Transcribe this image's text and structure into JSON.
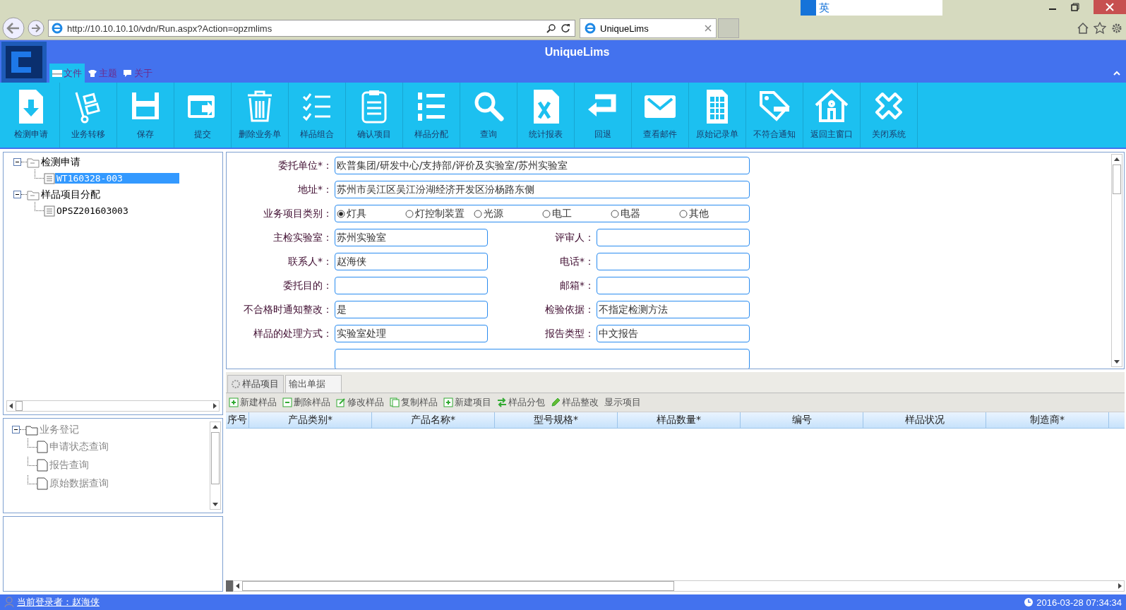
{
  "browser": {
    "url": "http://10.10.10.10/vdn/Run.aspx?Action=opzmlims",
    "tab_title": "UniqueLims",
    "ime_label": "英"
  },
  "app": {
    "title": "UniqueLims"
  },
  "menu": [
    {
      "label": "文件",
      "selected": true
    },
    {
      "label": "主题",
      "selected": false
    },
    {
      "label": "关于",
      "selected": false
    }
  ],
  "toolbar": [
    {
      "label": "检测申请"
    },
    {
      "label": "业务转移"
    },
    {
      "label": "保存"
    },
    {
      "label": "提交"
    },
    {
      "label": "删除业务单"
    },
    {
      "label": "样品组合"
    },
    {
      "label": "确认项目"
    },
    {
      "label": "样品分配"
    },
    {
      "label": "查询"
    },
    {
      "label": "统计报表"
    },
    {
      "label": "回退"
    },
    {
      "label": "查看邮件"
    },
    {
      "label": "原始记录单"
    },
    {
      "label": "不符合通知"
    },
    {
      "label": "返回主窗口"
    },
    {
      "label": "关闭系统"
    }
  ],
  "tree": [
    {
      "label": "检测申请",
      "expanded": true,
      "selected": false,
      "children": [
        {
          "label": "WT160328-003",
          "selected": true
        }
      ]
    },
    {
      "label": "样品项目分配",
      "expanded": true,
      "selected": false,
      "children": [
        {
          "label": "OPSZ201603003",
          "selected": false
        }
      ]
    }
  ],
  "nav_tree": [
    {
      "label": "业务登记",
      "expanded": true,
      "children": [
        {
          "label": "申请状态查询"
        },
        {
          "label": "报告查询"
        },
        {
          "label": "原始数据查询"
        }
      ]
    }
  ],
  "form": [
    {
      "kind": "wide",
      "label": "委托单位*：",
      "value": "欧普集团/研发中心/支持部/评价及实验室/苏州实验室"
    },
    {
      "kind": "wide",
      "label": "地址*：",
      "value": "苏州市吴江区吴江汾湖经济开发区汾杨路东侧"
    },
    {
      "kind": "radio",
      "label": "业务项目类别：",
      "options": [
        {
          "label": "灯具",
          "selected": true
        },
        {
          "label": "灯控制装置",
          "selected": false
        },
        {
          "label": "光源",
          "selected": false
        },
        {
          "label": "电工",
          "selected": false
        },
        {
          "label": "电器",
          "selected": false
        },
        {
          "label": "其他",
          "selected": false
        }
      ]
    },
    {
      "kind": "pair",
      "fields": [
        {
          "label": "主检实验室：",
          "value": "苏州实验室"
        },
        {
          "label": "评审人："
        }
      ]
    },
    {
      "kind": "pair",
      "fields": [
        {
          "label": "联系人*：",
          "value": "赵海侠"
        },
        {
          "label": "电话*："
        }
      ]
    },
    {
      "kind": "pair",
      "fields": [
        {
          "label": "委托目的："
        },
        {
          "label": "邮箱*："
        }
      ]
    },
    {
      "kind": "pair",
      "fields": [
        {
          "label": "不合格时通知整改：",
          "value": "是"
        },
        {
          "label": "检验依据：",
          "value": "不指定检测方法"
        }
      ]
    },
    {
      "kind": "pair",
      "fields": [
        {
          "label": "样品的处理方式：",
          "value": "实验室处理"
        },
        {
          "label": "报告类型：",
          "value": "中文报告"
        }
      ]
    },
    {
      "kind": "textarea"
    }
  ],
  "tabs": [
    {
      "label": "样品项目",
      "selected": true
    },
    {
      "label": "输出单据",
      "selected": false
    }
  ],
  "grid_toolbar": [
    {
      "label": "新建样品",
      "kind": "add"
    },
    {
      "label": "删除样品",
      "kind": "remove"
    },
    {
      "label": "修改样品",
      "kind": "edit"
    },
    {
      "label": "复制样品",
      "kind": "copy"
    },
    {
      "label": "新建项目",
      "kind": "add"
    },
    {
      "label": "样品分包",
      "kind": "swap"
    },
    {
      "label": "样品整改",
      "kind": "pencil"
    },
    {
      "label": "显示项目",
      "kind": "plain"
    }
  ],
  "grid": {
    "columns": [
      "序号",
      "产品类别*",
      "产品名称*",
      "型号规格*",
      "样品数量*",
      "编号",
      "样品状况",
      "制造商*"
    ]
  },
  "status_bar": {
    "user": "当前登录者：赵海侠",
    "time": "2016-03-28 07:34:34"
  }
}
